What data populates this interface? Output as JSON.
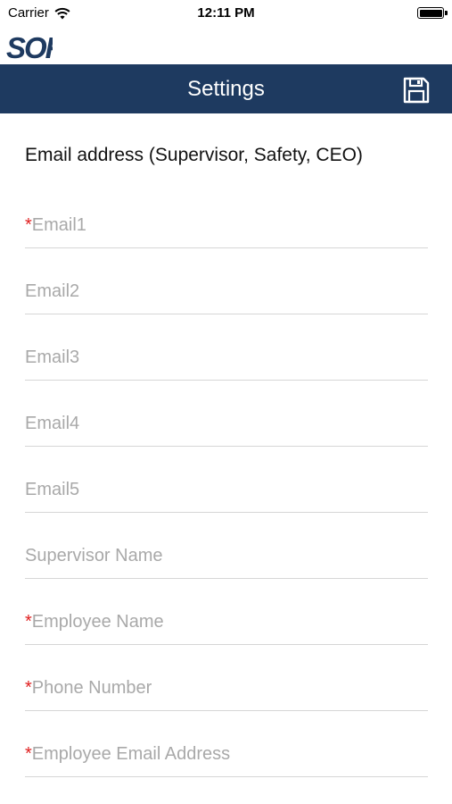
{
  "status_bar": {
    "carrier": "Carrier",
    "time": "12:11 PM"
  },
  "app": {
    "logo_text": "SOR",
    "brand_color": "#1e3a60"
  },
  "navbar": {
    "title": "Settings",
    "save_icon": "save-icon"
  },
  "form": {
    "heading": "Email address (Supervisor, Safety, CEO)",
    "required_marker": "*",
    "required_color": "#e02020",
    "fields": [
      {
        "placeholder": "Email1",
        "required": true
      },
      {
        "placeholder": "Email2",
        "required": false
      },
      {
        "placeholder": "Email3",
        "required": false
      },
      {
        "placeholder": "Email4",
        "required": false
      },
      {
        "placeholder": "Email5",
        "required": false
      },
      {
        "placeholder": "Supervisor Name",
        "required": false
      },
      {
        "placeholder": "Employee Name",
        "required": true
      },
      {
        "placeholder": "Phone Number",
        "required": true
      },
      {
        "placeholder": "Employee Email Address",
        "required": true
      }
    ]
  }
}
